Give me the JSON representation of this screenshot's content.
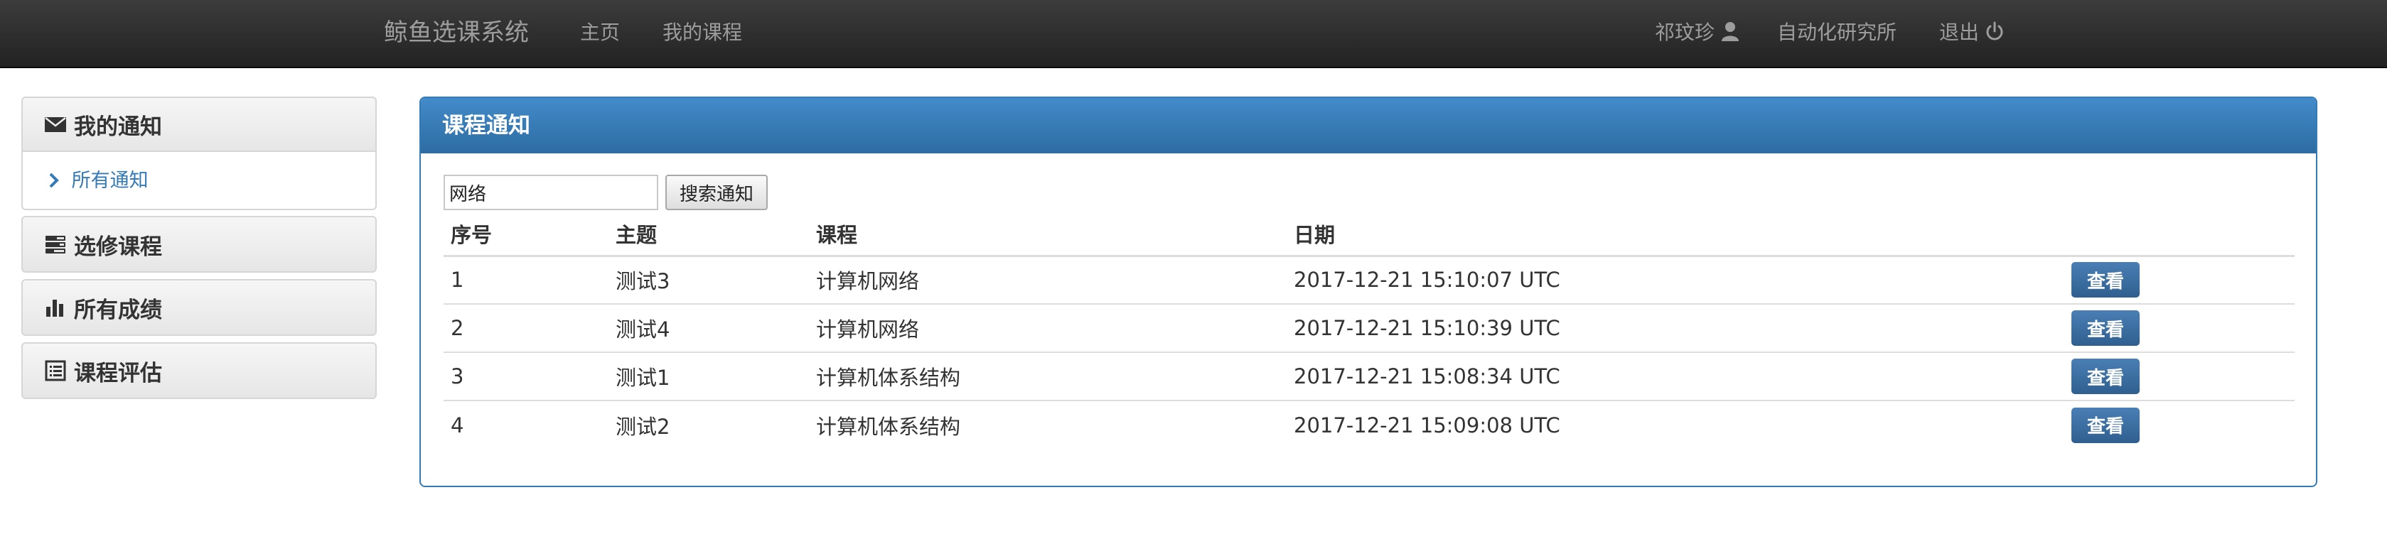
{
  "navbar": {
    "brand": "鲸鱼选课系统",
    "links": [
      "主页",
      "我的课程"
    ],
    "user_name": "祁玟珍",
    "department": "自动化研究所",
    "logout": "退出"
  },
  "sidebar": {
    "sections": [
      {
        "label": "我的通知",
        "icon": "envelope-icon"
      },
      {
        "label": "选修课程",
        "icon": "tasks-icon"
      },
      {
        "label": "所有成绩",
        "icon": "bar-chart-icon"
      },
      {
        "label": "课程评估",
        "icon": "list-alt-icon"
      }
    ],
    "active_sub": "所有通知"
  },
  "panel": {
    "title": "课程通知",
    "search": {
      "value": "网络",
      "button": "搜索通知"
    },
    "columns": [
      "序号",
      "主题",
      "课程",
      "日期"
    ],
    "rows": [
      {
        "no": "1",
        "topic": "测试3",
        "course": "计算机网络",
        "date": "2017-12-21 15:10:07 UTC",
        "action": "查看"
      },
      {
        "no": "2",
        "topic": "测试4",
        "course": "计算机网络",
        "date": "2017-12-21 15:10:39 UTC",
        "action": "查看"
      },
      {
        "no": "3",
        "topic": "测试1",
        "course": "计算机体系结构",
        "date": "2017-12-21 15:08:34 UTC",
        "action": "查看"
      },
      {
        "no": "4",
        "topic": "测试2",
        "course": "计算机体系结构",
        "date": "2017-12-21 15:09:08 UTC",
        "action": "查看"
      }
    ]
  },
  "colors": {
    "navbar": "#222222",
    "nav_text": "#9d9d9d",
    "panel_primary": "#337ab7",
    "link": "#337ab7"
  }
}
